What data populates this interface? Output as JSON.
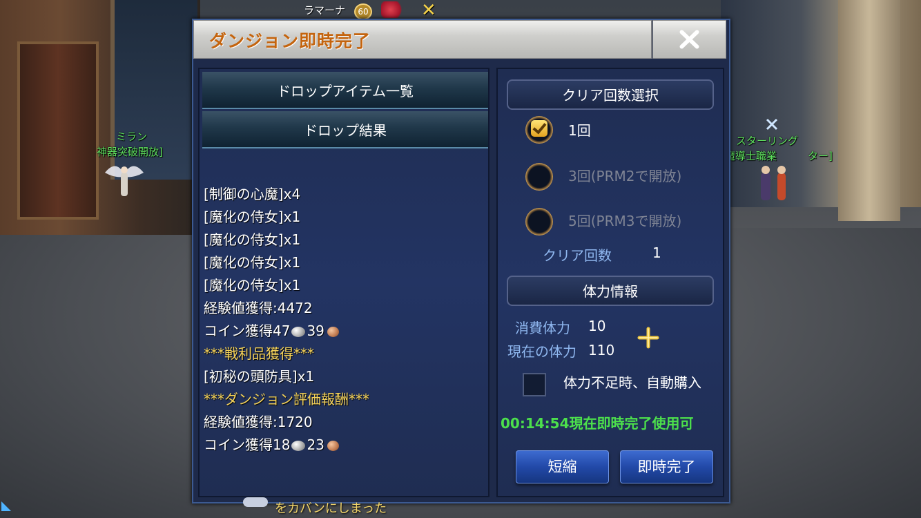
{
  "hud": {
    "top_player_name": "ラマーナ",
    "top_player_level": "60",
    "bottom_message": "をカバンにしまった"
  },
  "npcs": {
    "left_name": "ミラン",
    "left_title": "神器突破開放]",
    "right_name": "スターリング",
    "right_title": "魔導士職業　　　ター]"
  },
  "dialog": {
    "title": "ダンジョン即時完了",
    "close_icon": "close-icon",
    "accent_color": "#c4640e",
    "left": {
      "tab_drop_list": "ドロップアイテム一覧",
      "tab_drop_result": "ドロップ結果",
      "lines": [
        {
          "text": "[制御の心魔]x4",
          "style": "normal"
        },
        {
          "text": "[魔化の侍女]x1",
          "style": "normal"
        },
        {
          "text": "[魔化の侍女]x1",
          "style": "normal"
        },
        {
          "text": "[魔化の侍女]x1",
          "style": "normal"
        },
        {
          "text": "[魔化の侍女]x1",
          "style": "normal"
        },
        {
          "text": "経験値獲得:4472",
          "style": "normal"
        },
        {
          "text": "コイン獲得47",
          "silver_suffix": "39",
          "style": "coins"
        },
        {
          "text": "***戦利品獲得***",
          "style": "gold"
        },
        {
          "text": "[初秘の頭防具]x1",
          "style": "normal"
        },
        {
          "text": "***ダンジョン評価報酬***",
          "style": "gold"
        },
        {
          "text": "経験値獲得:1720",
          "style": "normal"
        },
        {
          "text": "コイン獲得18",
          "silver_suffix": "23",
          "style": "coins"
        }
      ]
    },
    "right": {
      "clear_count_header": "クリア回数選択",
      "options": [
        {
          "label": "1回",
          "checked": true
        },
        {
          "label": "3回(PRM2で開放)",
          "checked": false
        },
        {
          "label": "5回(PRM3で開放)",
          "checked": false
        }
      ],
      "clear_count_label": "クリア回数",
      "clear_count_value": "1",
      "stamina_header": "体力情報",
      "consumed_label": "消費体力",
      "consumed_value": "10",
      "current_label": "現在の体力",
      "current_value": "110",
      "auto_buy_label": "体力不足時、自動購入",
      "auto_buy_checked": false,
      "timer_text": "00:14:54現在即時完了使用可",
      "btn_shorten": "短縮",
      "btn_instant": "即時完了"
    }
  }
}
